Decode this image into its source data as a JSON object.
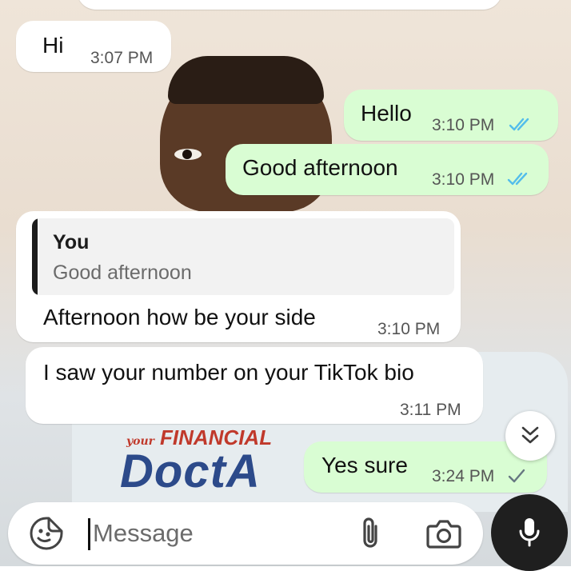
{
  "messages": [
    {
      "direction": "in",
      "text": "Hi",
      "time": "3:07 PM"
    },
    {
      "direction": "out",
      "text": "Hello",
      "time": "3:10 PM",
      "status": "read-double-tick-icon"
    },
    {
      "direction": "out",
      "text": "Good afternoon",
      "time": "3:10 PM",
      "status": "read-double-tick-icon"
    },
    {
      "direction": "in",
      "text": "Afternoon how be your side",
      "time": "3:10 PM",
      "reply_to": {
        "author": "You",
        "text": "Good afternoon"
      }
    },
    {
      "direction": "in",
      "text": "I saw your number on your TikTok bio",
      "time": "3:11 PM"
    },
    {
      "direction": "out",
      "text": "Yes sure",
      "time": "3:24 PM",
      "status": "sent-single-tick-icon"
    }
  ],
  "wallpaper": {
    "logo_small": "your",
    "logo_line1": "FINANCIAL",
    "logo_line2": "DoctA"
  },
  "composer": {
    "placeholder": "Message",
    "value": "",
    "icons": [
      "sticker-icon",
      "paperclip-icon",
      "camera-icon",
      "microphone-icon"
    ]
  },
  "scroll_button_icon": "double-chevron-down-icon",
  "colors": {
    "incoming_bubble": "#ffffff",
    "outgoing_bubble": "#d9fdd3",
    "read_tick": "#53bdeb",
    "sent_tick": "#667781",
    "mic_button": "#1f1f1f"
  }
}
